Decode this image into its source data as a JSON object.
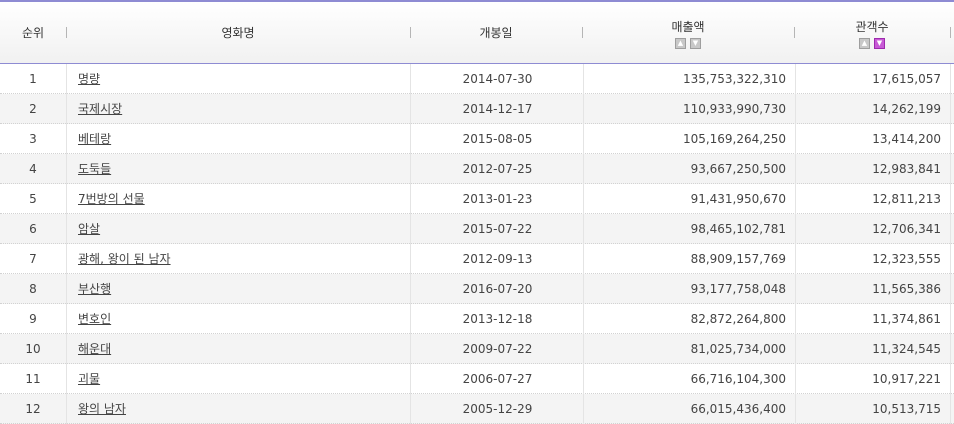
{
  "table": {
    "headers": {
      "rank": "순위",
      "title": "영화명",
      "release_date": "개봉일",
      "sales": "매출액",
      "audience": "관객수"
    },
    "sort_icons": {
      "up": "triangle-up-icon",
      "down": "triangle-down-icon",
      "active_color": "#c85ad6"
    },
    "rows": [
      {
        "rank": "1",
        "title": "명량",
        "date": "2014-07-30",
        "sales": "135,753,322,310",
        "audience": "17,615,057"
      },
      {
        "rank": "2",
        "title": "국제시장",
        "date": "2014-12-17",
        "sales": "110,933,990,730",
        "audience": "14,262,199"
      },
      {
        "rank": "3",
        "title": "베테랑",
        "date": "2015-08-05",
        "sales": "105,169,264,250",
        "audience": "13,414,200"
      },
      {
        "rank": "4",
        "title": "도둑들",
        "date": "2012-07-25",
        "sales": "93,667,250,500",
        "audience": "12,983,841"
      },
      {
        "rank": "5",
        "title": "7번방의 선물",
        "date": "2013-01-23",
        "sales": "91,431,950,670",
        "audience": "12,811,213"
      },
      {
        "rank": "6",
        "title": "암살",
        "date": "2015-07-22",
        "sales": "98,465,102,781",
        "audience": "12,706,341"
      },
      {
        "rank": "7",
        "title": "광해, 왕이 된 남자",
        "date": "2012-09-13",
        "sales": "88,909,157,769",
        "audience": "12,323,555"
      },
      {
        "rank": "8",
        "title": "부산행",
        "date": "2016-07-20",
        "sales": "93,177,758,048",
        "audience": "11,565,386"
      },
      {
        "rank": "9",
        "title": "변호인",
        "date": "2013-12-18",
        "sales": "82,872,264,800",
        "audience": "11,374,861"
      },
      {
        "rank": "10",
        "title": "해운대",
        "date": "2009-07-22",
        "sales": "81,025,734,000",
        "audience": "11,324,545"
      },
      {
        "rank": "11",
        "title": "괴물",
        "date": "2006-07-27",
        "sales": "66,716,104,300",
        "audience": "10,917,221"
      },
      {
        "rank": "12",
        "title": "왕의 남자",
        "date": "2005-12-29",
        "sales": "66,015,436,400",
        "audience": "10,513,715"
      }
    ]
  },
  "colors": {
    "accent_line": "#8e8bd3",
    "row_alt": "#f4f4f4"
  }
}
